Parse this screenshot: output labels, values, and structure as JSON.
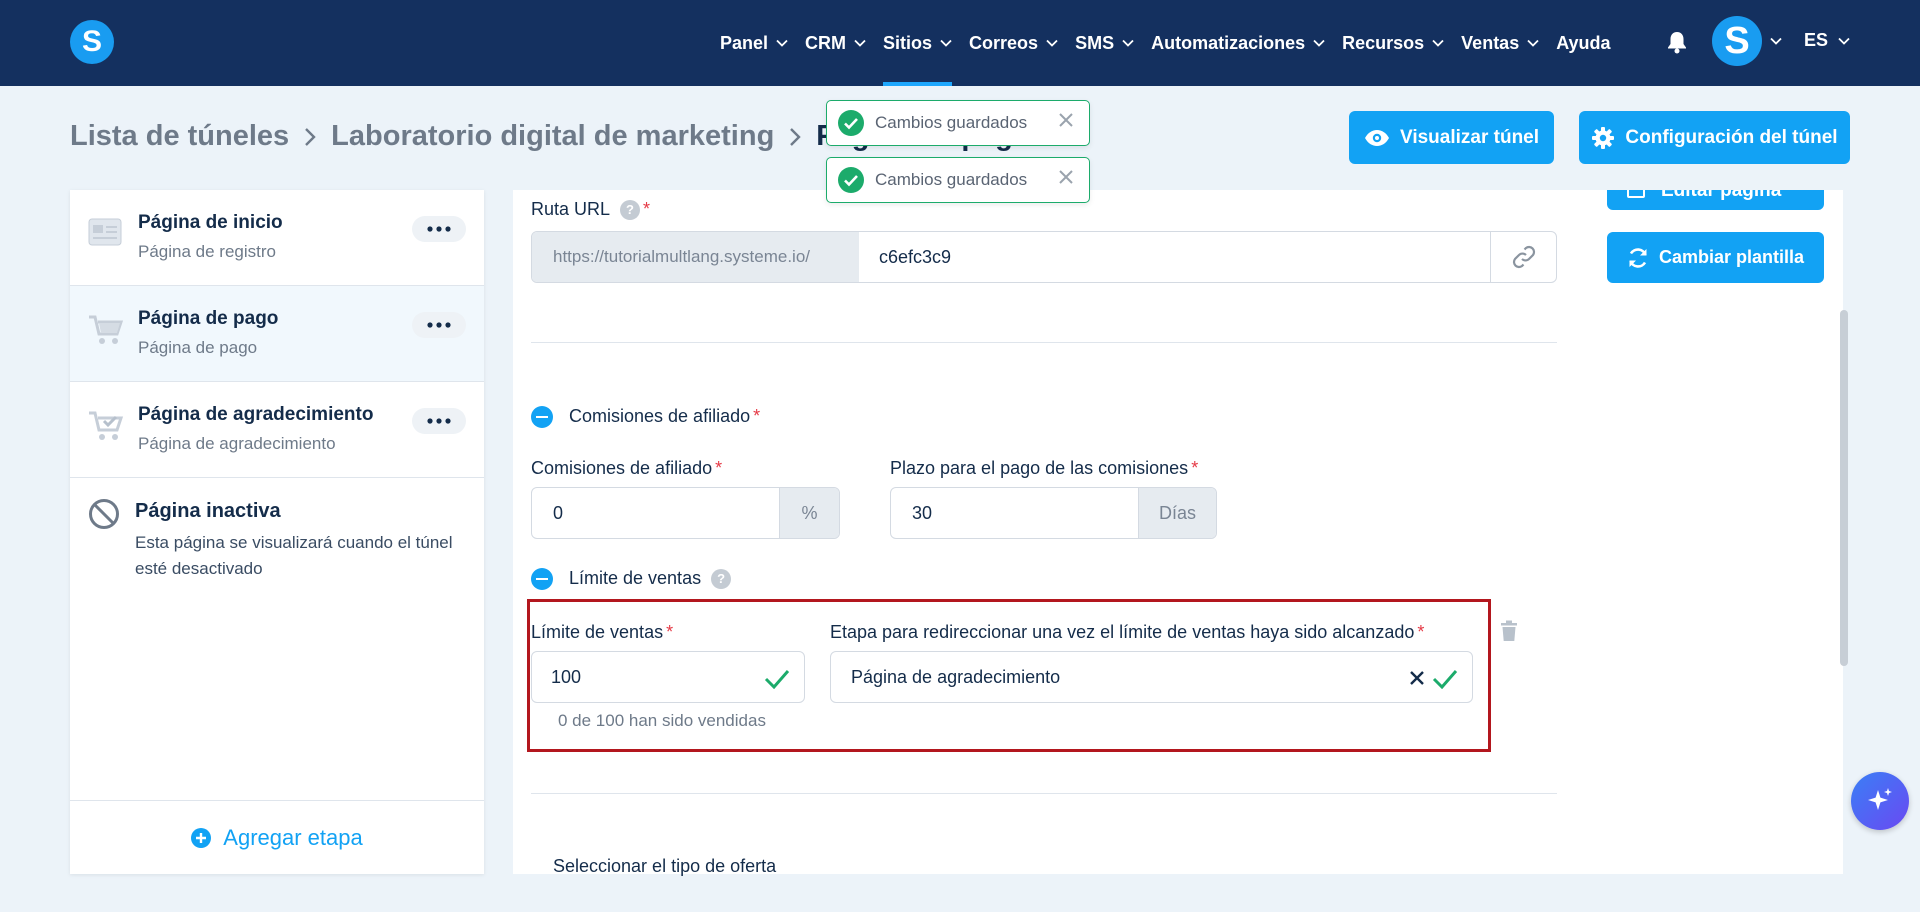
{
  "app": {
    "logo_letter": "S",
    "avatar_letter": "S",
    "language": "ES"
  },
  "colors": {
    "nav_bg": "#14305f",
    "accent": "#12a2f4",
    "success": "#1cab6b",
    "highlight_box": "#b3171e",
    "required": "#e53945"
  },
  "nav": {
    "items": [
      {
        "label": "Panel",
        "dropdown": true
      },
      {
        "label": "CRM",
        "dropdown": true
      },
      {
        "label": "Sitios",
        "dropdown": true,
        "active": true
      },
      {
        "label": "Correos",
        "dropdown": true
      },
      {
        "label": "SMS",
        "dropdown": true
      },
      {
        "label": "Automatizaciones",
        "dropdown": true
      },
      {
        "label": "Recursos",
        "dropdown": true
      },
      {
        "label": "Ventas",
        "dropdown": true
      },
      {
        "label": "Ayuda",
        "dropdown": false
      }
    ]
  },
  "breadcrumb": {
    "items": [
      "Lista de túneles",
      "Laboratorio digital de marketing",
      "Página de pago"
    ]
  },
  "header_buttons": {
    "preview": "Visualizar túnel",
    "settings": "Configuración del túnel"
  },
  "toasts": [
    {
      "text": "Cambios guardados"
    },
    {
      "text": "Cambios guardados"
    }
  ],
  "sidebar": {
    "steps": [
      {
        "title": "Página de inicio",
        "subtitle": "Página de registro",
        "icon": "page-icon"
      },
      {
        "title": "Página de pago",
        "subtitle": "Página de pago",
        "icon": "cart-icon",
        "selected": true
      },
      {
        "title": "Página de agradecimiento",
        "subtitle": "Página de agradecimiento",
        "icon": "cart-check-icon"
      }
    ],
    "inactive": {
      "title": "Página inactiva",
      "description": "Esta página se visualizará cuando el túnel esté desactivado"
    },
    "add_step": "Agregar etapa"
  },
  "right_buttons": {
    "edit_page": "Editar página",
    "change_template": "Cambiar plantilla"
  },
  "form": {
    "url": {
      "label": "Ruta URL",
      "prefix": "https://tutorialmultlang.systeme.io/",
      "value": "c6efc3c9"
    },
    "affiliate_section": {
      "label": "Comisiones de afiliado"
    },
    "commission": {
      "label": "Comisiones de afiliado",
      "value": "0",
      "unit": "%"
    },
    "payment_term": {
      "label": "Plazo para el pago de las comisiones",
      "value": "30",
      "unit": "Días"
    },
    "sales_limit_section": {
      "label": "Límite de ventas"
    },
    "sales_limit": {
      "label": "Límite de ventas",
      "value": "100",
      "helper": "0 de 100 han sido vendidas"
    },
    "redirect_step": {
      "label": "Etapa para redireccionar una vez el límite de ventas haya sido alcanzado",
      "value": "Página de agradecimiento"
    },
    "offer_type": {
      "label": "Seleccionar el tipo de oferta"
    }
  }
}
